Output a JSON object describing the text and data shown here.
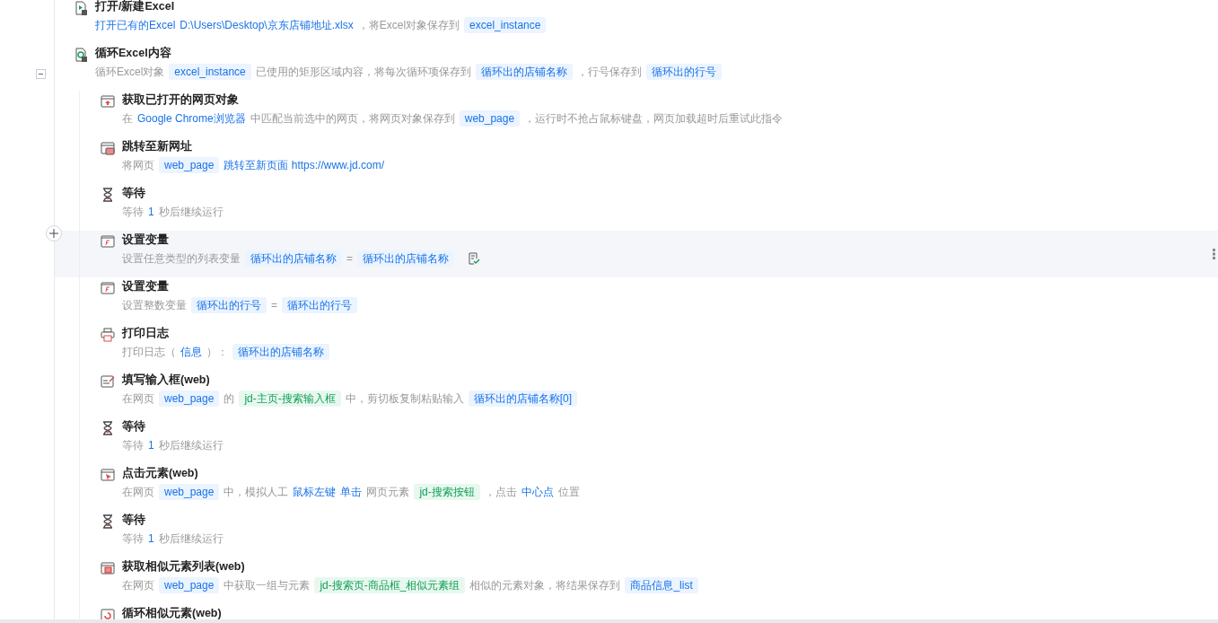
{
  "steps": [
    {
      "kind": "open_excel",
      "title": "打开/新建Excel",
      "selected": false,
      "description": [
        {
          "kind": "link",
          "text": "打开已有的Excel"
        },
        {
          "kind": "link",
          "text": "D:\\Users\\Desktop\\京东店铺地址.xlsx"
        },
        {
          "kind": "text",
          "text": "，将Excel对象保存到"
        },
        {
          "kind": "var",
          "text": "excel_instance"
        }
      ]
    },
    {
      "kind": "loop_excel",
      "title": "循环Excel内容",
      "selected": false,
      "expanded": true,
      "description": [
        {
          "kind": "text",
          "text": "循环Excel对象"
        },
        {
          "kind": "var",
          "text": "excel_instance"
        },
        {
          "kind": "text",
          "text": "已使用的矩形区域内容，将每次循环项保存到"
        },
        {
          "kind": "var",
          "text": "循环出的店铺名称"
        },
        {
          "kind": "text",
          "text": "，行号保存到"
        },
        {
          "kind": "var",
          "text": "循环出的行号"
        }
      ],
      "children": [
        {
          "kind": "get_page",
          "title": "获取已打开的网页对象",
          "selected": false,
          "description": [
            {
              "kind": "text",
              "text": "在"
            },
            {
              "kind": "link",
              "text": "Google Chrome浏览器"
            },
            {
              "kind": "text",
              "text": "中匹配当前选中的网页，将网页对象保存到"
            },
            {
              "kind": "var",
              "text": "web_page"
            },
            {
              "kind": "text",
              "text": "，运行时不抢占鼠标键盘，网页加载超时后重试此指令"
            }
          ]
        },
        {
          "kind": "goto_url",
          "title": "跳转至新网址",
          "selected": false,
          "description": [
            {
              "kind": "text",
              "text": "将网页"
            },
            {
              "kind": "var",
              "text": "web_page"
            },
            {
              "kind": "link",
              "text": "跳转至新页面 https://www.jd.com/"
            }
          ]
        },
        {
          "kind": "wait",
          "title": "等待",
          "selected": false,
          "description": [
            {
              "kind": "text",
              "text": "等待"
            },
            {
              "kind": "link",
              "text": "1"
            },
            {
              "kind": "text",
              "text": "秒后继续运行"
            }
          ]
        },
        {
          "kind": "set_var",
          "title": "设置变量",
          "selected": true,
          "verified": true,
          "description": [
            {
              "kind": "text",
              "text": "设置任意类型的列表变量"
            },
            {
              "kind": "var",
              "text": "循环出的店铺名称"
            },
            {
              "kind": "text",
              "text": "="
            },
            {
              "kind": "var",
              "text": "循环出的店铺名称"
            }
          ]
        },
        {
          "kind": "set_var",
          "title": "设置变量",
          "selected": false,
          "description": [
            {
              "kind": "text",
              "text": "设置整数变量"
            },
            {
              "kind": "var",
              "text": "循环出的行号"
            },
            {
              "kind": "text",
              "text": "="
            },
            {
              "kind": "var",
              "text": "循环出的行号"
            }
          ]
        },
        {
          "kind": "log",
          "title": "打印日志",
          "selected": false,
          "description": [
            {
              "kind": "text",
              "text": "打印日志（"
            },
            {
              "kind": "link",
              "text": "信息"
            },
            {
              "kind": "text",
              "text": "）："
            },
            {
              "kind": "var",
              "text": "循环出的店铺名称"
            }
          ]
        },
        {
          "kind": "fill_input",
          "title": "填写输入框(web)",
          "selected": false,
          "description": [
            {
              "kind": "text",
              "text": "在网页"
            },
            {
              "kind": "var",
              "text": "web_page"
            },
            {
              "kind": "text",
              "text": "的"
            },
            {
              "kind": "element",
              "text": "jd-主页-搜索输入框"
            },
            {
              "kind": "text",
              "text": "中，剪切板复制粘贴输入"
            },
            {
              "kind": "var",
              "text": "循环出的店铺名称[0]"
            }
          ]
        },
        {
          "kind": "wait",
          "title": "等待",
          "selected": false,
          "description": [
            {
              "kind": "text",
              "text": "等待"
            },
            {
              "kind": "link",
              "text": "1"
            },
            {
              "kind": "text",
              "text": "秒后继续运行"
            }
          ]
        },
        {
          "kind": "click",
          "title": "点击元素(web)",
          "selected": false,
          "description": [
            {
              "kind": "text",
              "text": "在网页"
            },
            {
              "kind": "var",
              "text": "web_page"
            },
            {
              "kind": "text",
              "text": "中，模拟人工"
            },
            {
              "kind": "link",
              "text": "鼠标左键"
            },
            {
              "kind": "link",
              "text": "单击"
            },
            {
              "kind": "text",
              "text": "网页元素"
            },
            {
              "kind": "element",
              "text": "jd-搜索按钮"
            },
            {
              "kind": "text",
              "text": "，点击"
            },
            {
              "kind": "link",
              "text": "中心点"
            },
            {
              "kind": "text",
              "text": "位置"
            }
          ]
        },
        {
          "kind": "wait",
          "title": "等待",
          "selected": false,
          "description": [
            {
              "kind": "text",
              "text": "等待"
            },
            {
              "kind": "link",
              "text": "1"
            },
            {
              "kind": "text",
              "text": "秒后继续运行"
            }
          ]
        },
        {
          "kind": "similar_list",
          "title": "获取相似元素列表(web)",
          "selected": false,
          "description": [
            {
              "kind": "text",
              "text": "在网页"
            },
            {
              "kind": "var",
              "text": "web_page"
            },
            {
              "kind": "text",
              "text": "中获取一组与元素"
            },
            {
              "kind": "element",
              "text": "jd-搜索页-商品框_相似元素组"
            },
            {
              "kind": "text",
              "text": "相似的元素对象，将结果保存到"
            },
            {
              "kind": "var",
              "text": "商品信息_list"
            }
          ]
        },
        {
          "kind": "loop_similar",
          "title": "循环相似元素(web)",
          "selected": false
        }
      ]
    }
  ]
}
